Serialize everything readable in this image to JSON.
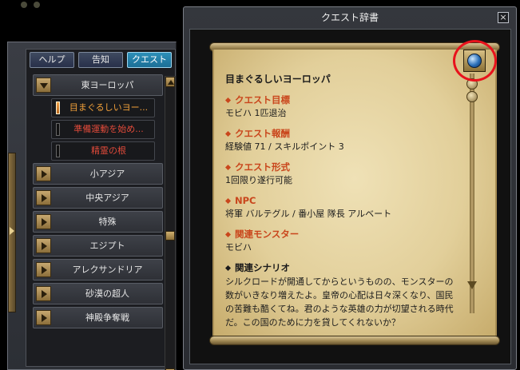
{
  "window": {
    "title": "クエスト辞書",
    "close_label": "×"
  },
  "tabs": [
    {
      "label": "ヘルプ",
      "active": false
    },
    {
      "label": "告知",
      "active": false
    },
    {
      "label": "クエスト",
      "active": true
    }
  ],
  "categories": {
    "east_europe": "東ヨーロッパ",
    "asia_minor": "小アジア",
    "central_asia": "中央アジア",
    "special": "特殊",
    "egypt": "エジプト",
    "alexandria": "アレクサンドリア",
    "desert_superman": "砂漠の超人",
    "temple_war": "神殿争奪戦"
  },
  "quests": [
    {
      "label": "目まぐるしいヨー...",
      "color": "orange",
      "active": true
    },
    {
      "label": "準備運動を始め...",
      "color": "red",
      "active": false
    },
    {
      "label": "精霊の根",
      "color": "red",
      "active": false
    }
  ],
  "detail": {
    "title": "目まぐるしいヨーロッパ",
    "objective_h": "クエスト目標",
    "objective_v": "モビハ 1匹退治",
    "reward_h": "クエスト報酬",
    "reward_v": "経験値 71 / スキルポイント 3",
    "format_h": "クエスト形式",
    "format_v": "1回限り遂行可能",
    "npc_h": "NPC",
    "npc_v": "将軍 バルテグル / 番小屋 隊長 アルベート",
    "monster_h": "関連モンスター",
    "monster_v": "モビハ",
    "scenario_h": "関連シナリオ",
    "scenario_v": "シルクロードが開通してからというものの、モンスターの数がいきなり増えたよ。皇帝の心配は日々深くなり、国民の苦難も酷くてね。君のような英雄の力が切望される時代だ。この国のために力を貸してくれないか？"
  },
  "colors": {
    "accent_tab": "#2d8fb8",
    "heading_orange": "#c9461c",
    "quest_orange": "#f2a13a",
    "quest_red": "#e04a3a",
    "highlight_ring": "#e8121c"
  },
  "icons": {
    "globe": "globe-icon",
    "close": "close-icon",
    "expand": "triangle-right-icon",
    "collapse": "triangle-down-icon"
  }
}
